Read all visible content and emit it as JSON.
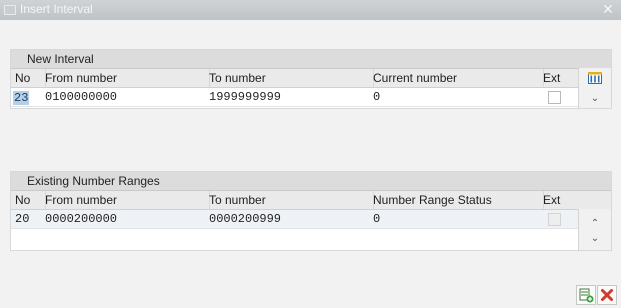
{
  "window": {
    "title": "Insert Interval"
  },
  "new_interval": {
    "title": "New Interval",
    "columns": [
      "No",
      "From number",
      "To number",
      "Current number",
      "Ext"
    ],
    "row": {
      "no": "23",
      "from": "0100000000",
      "to": "1999999999",
      "current": "0"
    }
  },
  "existing": {
    "title": "Existing Number Ranges",
    "columns": [
      "No",
      "From number",
      "To number",
      "Number Range Status",
      "Ext"
    ],
    "rows": [
      {
        "no": "20",
        "from": "0000200000",
        "to": "0000200999",
        "status": "0"
      }
    ]
  },
  "icons": {
    "column_selection": "column-selection-icon",
    "scroll_down": "chevron-down-icon",
    "scroll_up": "chevron-up-icon",
    "confirm": "insert-row-icon",
    "cancel": "cancel-icon"
  },
  "colors": {
    "accent_blue": "#2a6db3",
    "cancel_red": "#d23b2a",
    "confirm_green": "#3aa23a"
  }
}
